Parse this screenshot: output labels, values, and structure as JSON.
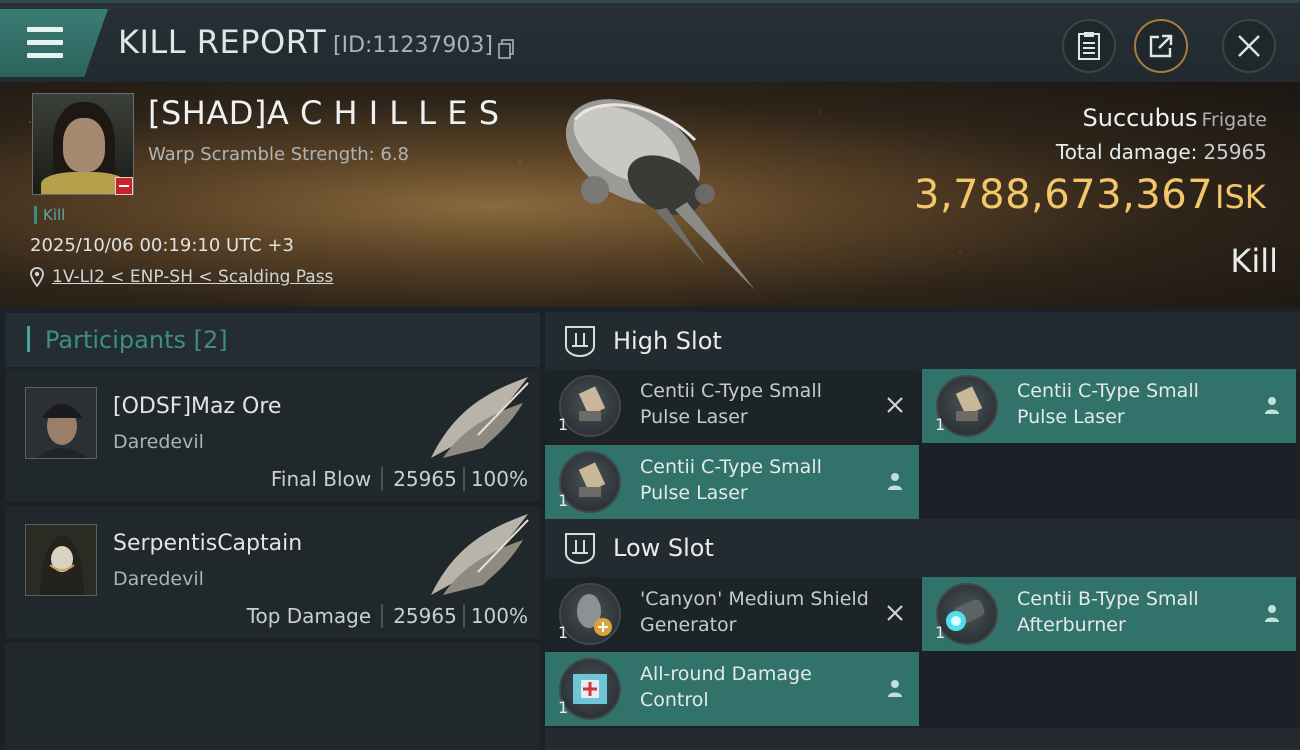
{
  "header": {
    "title": "KILL REPORT",
    "report_id": "[ID:11237903]"
  },
  "victim": {
    "name": "[SHAD]A C H I L L E S",
    "warp_scramble": "Warp Scramble Strength: 6.8",
    "kill_tag": "Kill",
    "datetime": "2025/10/06 00:19:10 UTC +3",
    "location": "1V-LI2 < ENP-SH < Scalding Pass",
    "ship_name": "Succubus",
    "ship_class": "Frigate",
    "total_damage_label": "Total damage:",
    "total_damage_value": "25965",
    "isk_value": "3,788,673,367",
    "isk_unit": "ISK",
    "result": "Kill"
  },
  "participants": {
    "label": "Participants [2]",
    "items": [
      {
        "name": "[ODSF]Maz Ore",
        "ship": "Daredevil",
        "role": "Final Blow",
        "damage": "25965",
        "percent": "100%"
      },
      {
        "name": "SerpentisCaptain",
        "ship": "Daredevil",
        "role": "Top Damage",
        "damage": "25965",
        "percent": "100%"
      }
    ]
  },
  "slots": {
    "high": {
      "label": "High Slot",
      "modules": [
        {
          "name": "Centii C-Type Small Pulse Laser",
          "qty": "1",
          "state": "destroyed"
        },
        {
          "name": "Centii C-Type Small Pulse Laser",
          "qty": "1",
          "state": "dropped"
        },
        {
          "name": "Centii C-Type Small Pulse Laser",
          "qty": "1",
          "state": "dropped"
        }
      ]
    },
    "low": {
      "label": "Low Slot",
      "modules": [
        {
          "name": "'Canyon' Medium Shield Generator",
          "qty": "1",
          "state": "destroyed"
        },
        {
          "name": "Centii B-Type Small Afterburner",
          "qty": "1",
          "state": "dropped"
        },
        {
          "name": "All-round Damage Control",
          "qty": "1",
          "state": "dropped"
        }
      ]
    }
  },
  "icons": {
    "menu": "hamburger-icon",
    "copy": "copy-icon",
    "report": "clipboard-icon",
    "share": "share-icon",
    "close": "close-icon",
    "location": "map-pin-icon",
    "slot": "slot-icon",
    "destroyed": "x-icon",
    "dropped": "person-icon"
  },
  "colors": {
    "accent": "#31726b",
    "isk": "#f2c66a",
    "participants_label": "#3f8d87"
  }
}
